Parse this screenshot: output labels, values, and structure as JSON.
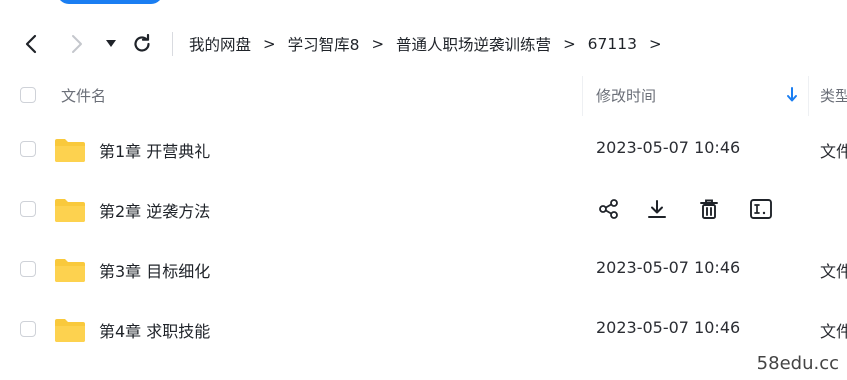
{
  "nav": {
    "back_icon": "chevron-left-icon",
    "forward_icon": "chevron-right-icon",
    "history_icon": "caret-down-icon",
    "refresh_icon": "refresh-icon",
    "breadcrumbs": [
      "我的网盘",
      "学习智库8",
      "普通人职场逆袭训练营",
      "67113"
    ],
    "separator": ">"
  },
  "header": {
    "name": "文件名",
    "modified": "修改时间",
    "type": "类型",
    "sort_icon": "arrow-down-icon"
  },
  "files": [
    {
      "name": "第1章 开营典礼",
      "modified": "2023-05-07 10:46",
      "type": "文件夹",
      "hovered": false
    },
    {
      "name": "第2章 逆袭方法",
      "modified": "",
      "type": "",
      "hovered": true
    },
    {
      "name": "第3章 目标细化",
      "modified": "2023-05-07 10:46",
      "type": "文件夹",
      "hovered": false
    },
    {
      "name": "第4章 求职技能",
      "modified": "2023-05-07 10:46",
      "type": "文件夹",
      "hovered": false
    }
  ],
  "row_actions": [
    "share-icon",
    "download-icon",
    "delete-icon",
    "rename-icon"
  ],
  "watermark": "58edu.cc",
  "colors": {
    "accent": "#1a7ef2",
    "folder": "#f9c93c"
  }
}
